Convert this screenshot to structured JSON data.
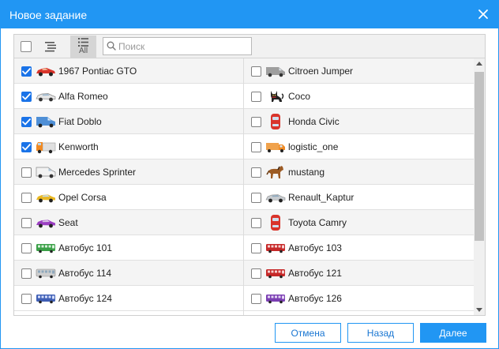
{
  "dialog": {
    "title": "Новое задание",
    "close_icon": "close-icon"
  },
  "toolbar": {
    "all_label": "All",
    "search_placeholder": "Поиск",
    "search_value": ""
  },
  "items": [
    {
      "left": {
        "name": "1967 Pontiac GTO",
        "checked": true,
        "icon": "red-sports-car"
      },
      "right": {
        "name": "Citroen Jumper",
        "checked": false,
        "icon": "gray-van"
      }
    },
    {
      "left": {
        "name": "Alfa Romeo",
        "checked": true,
        "icon": "white-sedan"
      },
      "right": {
        "name": "Coco",
        "checked": false,
        "icon": "black-cat"
      }
    },
    {
      "left": {
        "name": "Fiat Doblo",
        "checked": true,
        "icon": "blue-van"
      },
      "right": {
        "name": "Honda Civic",
        "checked": false,
        "icon": "red-car-topview"
      }
    },
    {
      "left": {
        "name": "Kenworth",
        "checked": true,
        "icon": "orange-truck"
      },
      "right": {
        "name": "logistic_one",
        "checked": false,
        "icon": "orange-cargo-truck"
      }
    },
    {
      "left": {
        "name": "Mercedes Sprinter",
        "checked": false,
        "icon": "white-van"
      },
      "right": {
        "name": "mustang",
        "checked": false,
        "icon": "brown-horse"
      }
    },
    {
      "left": {
        "name": "Opel Corsa",
        "checked": false,
        "icon": "yellow-car"
      },
      "right": {
        "name": "Renault_Kaptur",
        "checked": false,
        "icon": "silver-car"
      }
    },
    {
      "left": {
        "name": "Seat",
        "checked": false,
        "icon": "purple-car"
      },
      "right": {
        "name": "Toyota Camry",
        "checked": false,
        "icon": "red-car-topview"
      }
    },
    {
      "left": {
        "name": "Автобус 101",
        "checked": false,
        "icon": "green-bus"
      },
      "right": {
        "name": "Автобус 103",
        "checked": false,
        "icon": "red-bus"
      }
    },
    {
      "left": {
        "name": "Автобус 114",
        "checked": false,
        "icon": "gray-bus"
      },
      "right": {
        "name": "Автобус 121",
        "checked": false,
        "icon": "red-bus"
      }
    },
    {
      "left": {
        "name": "Автобус 124",
        "checked": false,
        "icon": "blue-bus"
      },
      "right": {
        "name": "Автобус 126",
        "checked": false,
        "icon": "purple-bus"
      }
    }
  ],
  "buttons": {
    "cancel": "Отмена",
    "back": "Назад",
    "next": "Далее"
  },
  "colors": {
    "accent": "#2196F3",
    "checkbox_checked": "#1a73e8"
  }
}
